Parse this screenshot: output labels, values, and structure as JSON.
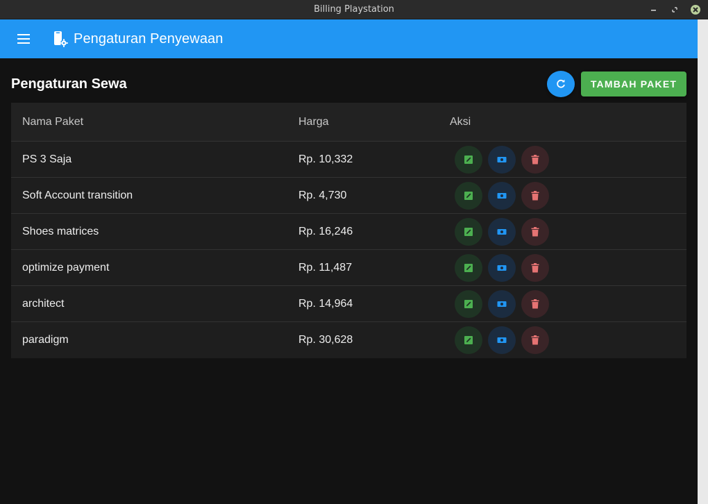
{
  "window": {
    "title": "Billing Playstation",
    "controls": [
      "minimize-icon",
      "restore-icon",
      "close-icon"
    ]
  },
  "appbar": {
    "menu_icon": "menu-icon",
    "app_icon": "phone-settings-icon",
    "title": "Pengaturan Penyewaan"
  },
  "page": {
    "title": "Pengaturan Sewa",
    "refresh_icon": "refresh-icon",
    "add_label": "TAMBAH PAKET"
  },
  "table": {
    "headers": {
      "name": "Nama Paket",
      "price": "Harga",
      "actions": "Aksi"
    },
    "rows": [
      {
        "name": "PS 3 Saja",
        "price": "Rp. 10,332"
      },
      {
        "name": "Soft Account transition",
        "price": "Rp. 4,730"
      },
      {
        "name": "Shoes matrices",
        "price": "Rp. 16,246"
      },
      {
        "name": "optimize payment",
        "price": "Rp. 11,487"
      },
      {
        "name": "architect",
        "price": "Rp. 14,964"
      },
      {
        "name": "paradigm",
        "price": "Rp. 30,628"
      }
    ],
    "row_actions": [
      "edit-icon",
      "view-icon",
      "delete-icon"
    ]
  },
  "colors": {
    "primary": "#2196f3",
    "success": "#4caf50",
    "edit": "#4caf50",
    "view": "#2196f3",
    "delete": "#e57373",
    "background": "#121212",
    "surface": "#1e1e1e"
  }
}
